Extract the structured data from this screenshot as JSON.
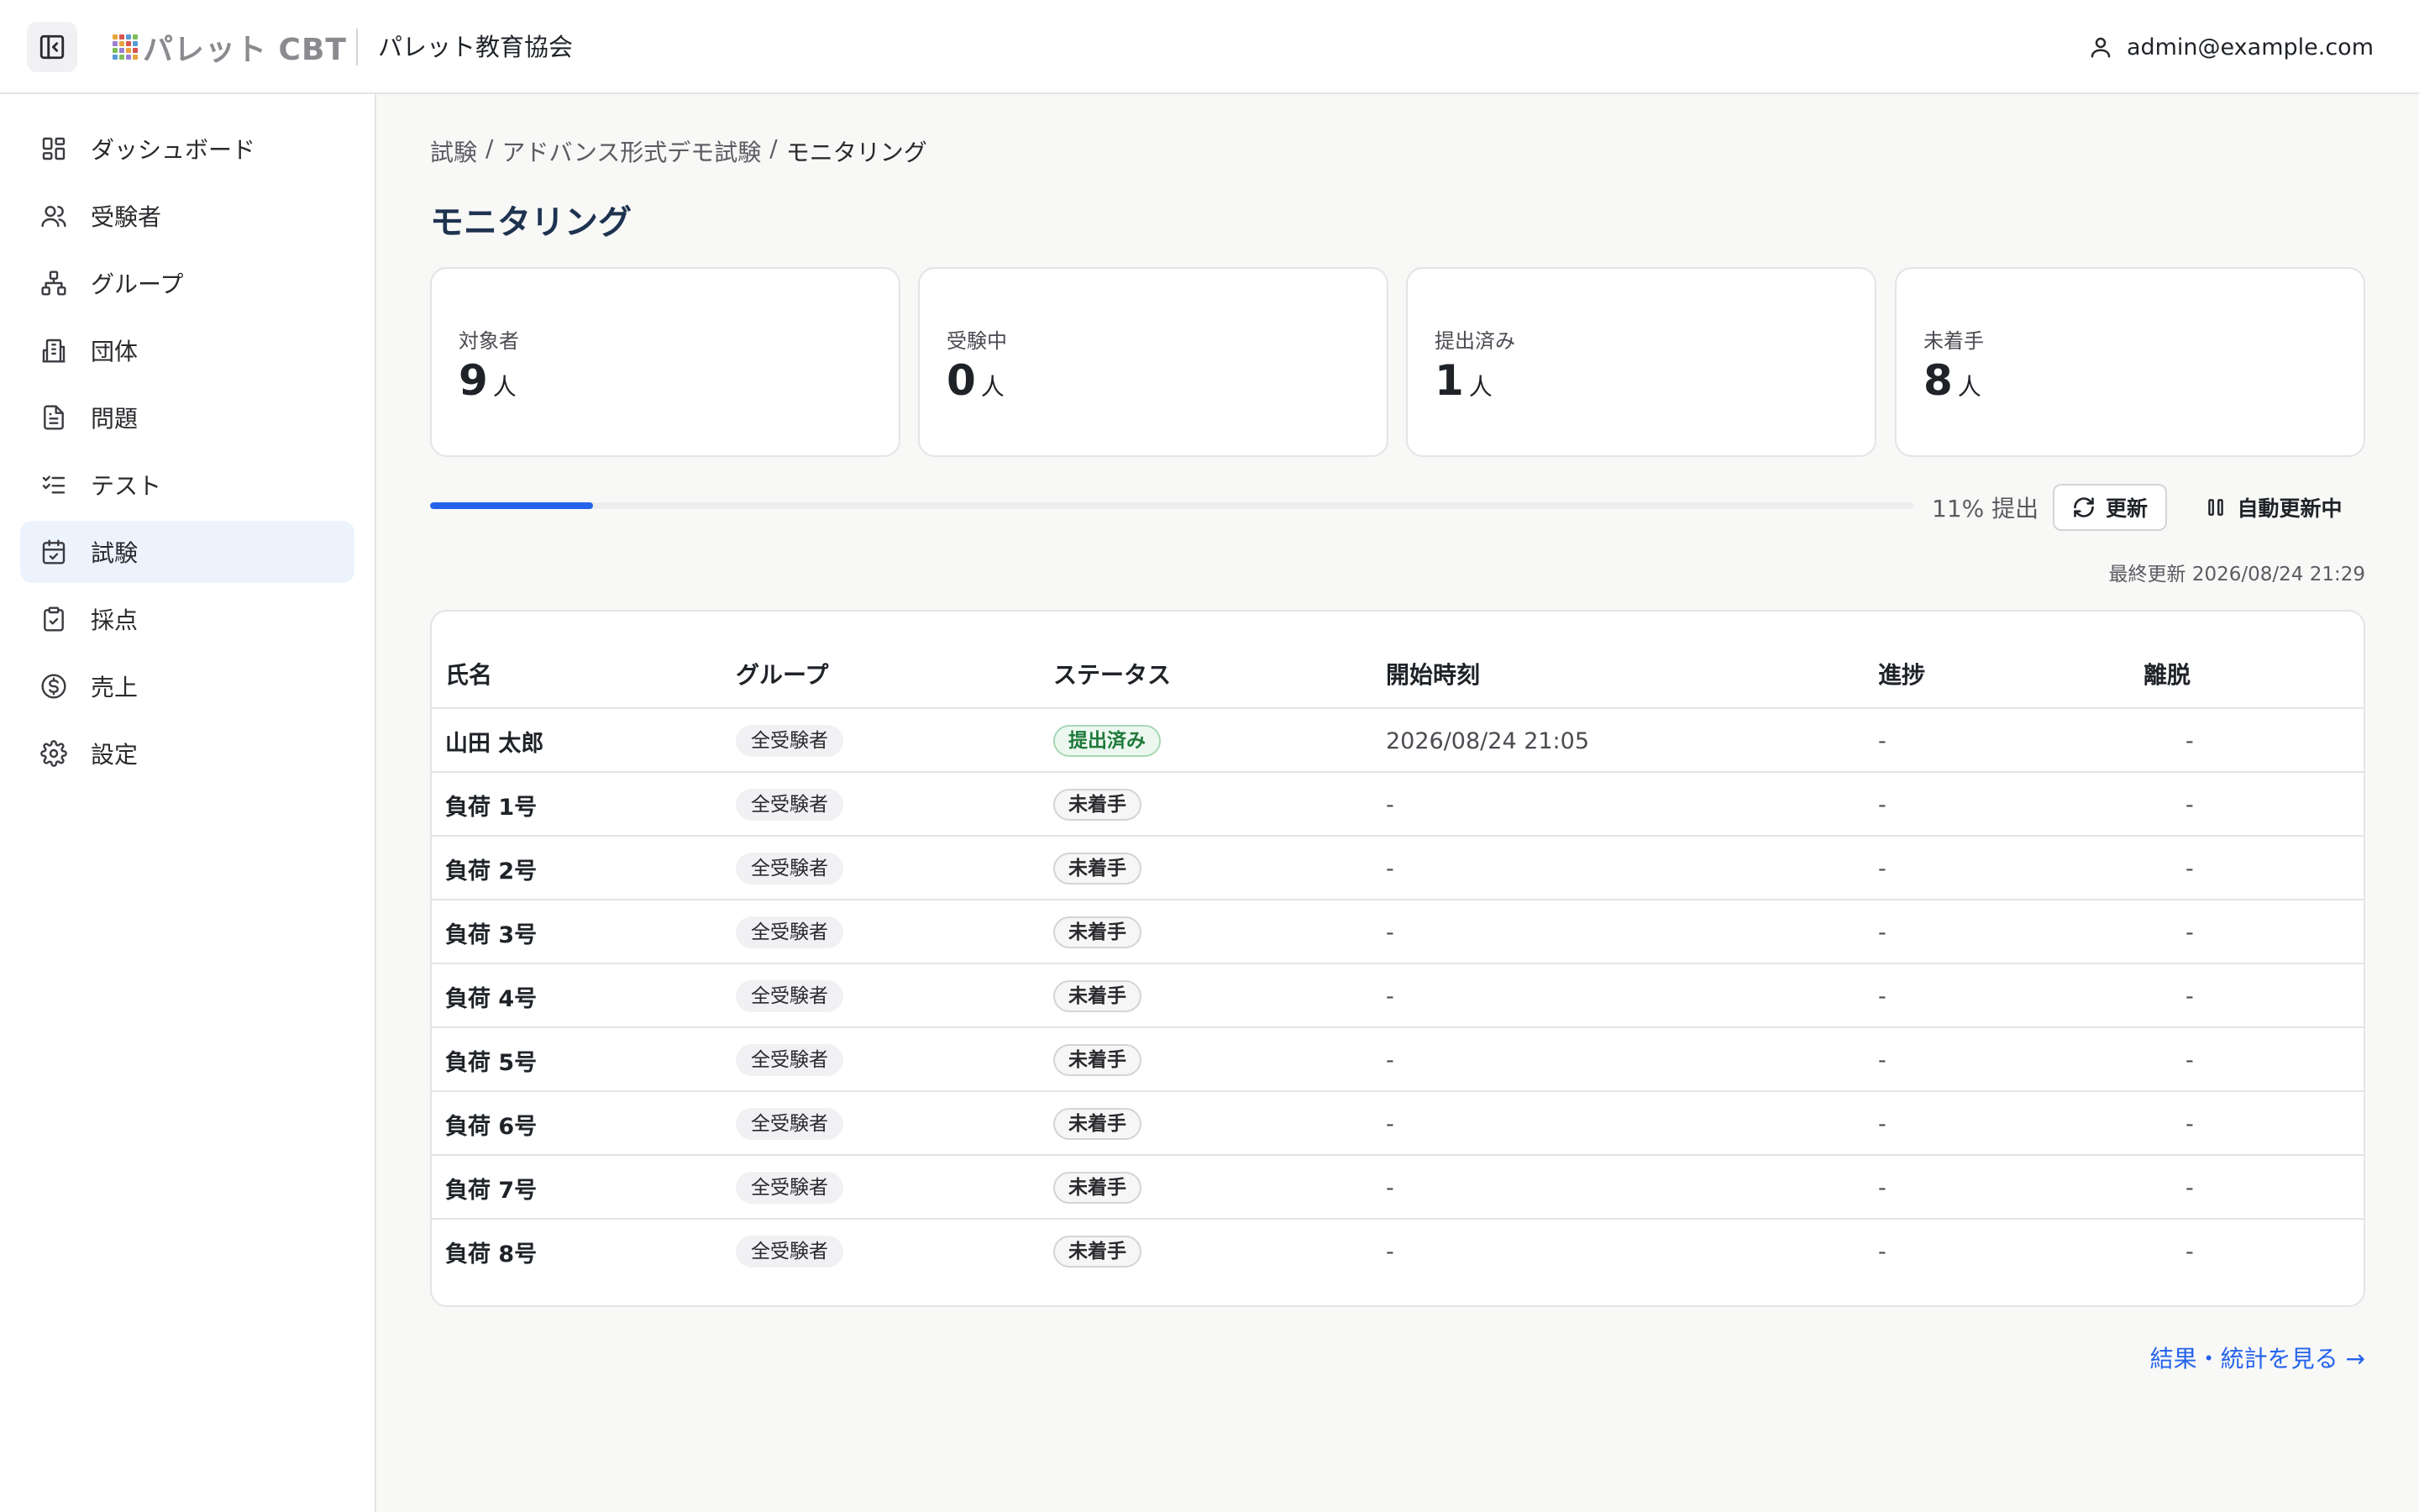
{
  "header": {
    "logo_text": "パレット CBT",
    "org_name": "パレット教育協会",
    "user_email": "admin@example.com"
  },
  "sidebar": {
    "items": [
      {
        "label": "ダッシュボード",
        "icon": "dashboard-icon"
      },
      {
        "label": "受験者",
        "icon": "users-icon"
      },
      {
        "label": "グループ",
        "icon": "network-icon"
      },
      {
        "label": "団体",
        "icon": "building-icon"
      },
      {
        "label": "問題",
        "icon": "document-icon"
      },
      {
        "label": "テスト",
        "icon": "checklist-icon"
      },
      {
        "label": "試験",
        "icon": "calendar-check-icon",
        "active": true
      },
      {
        "label": "採点",
        "icon": "clipboard-check-icon"
      },
      {
        "label": "売上",
        "icon": "dollar-icon"
      },
      {
        "label": "設定",
        "icon": "gear-icon"
      }
    ]
  },
  "breadcrumb": {
    "items": [
      "試験",
      "アドバンス形式デモ試験",
      "モニタリング"
    ],
    "separator": "/"
  },
  "page_title": "モニタリング",
  "stats": [
    {
      "label": "対象者",
      "value": "9",
      "unit": "人"
    },
    {
      "label": "受験中",
      "value": "0",
      "unit": "人"
    },
    {
      "label": "提出済み",
      "value": "1",
      "unit": "人"
    },
    {
      "label": "未着手",
      "value": "8",
      "unit": "人"
    }
  ],
  "progress": {
    "fraction": 0.11,
    "text": "11% 提出",
    "refresh_label": "更新",
    "auto_label": "自動更新中",
    "last_updated": "最終更新 2026/08/24 21:29"
  },
  "table": {
    "columns": [
      "氏名",
      "グループ",
      "ステータス",
      "開始時刻",
      "進捗",
      "離脱"
    ],
    "rows": [
      {
        "name": "山田 太郎",
        "group": "全受験者",
        "status": "提出済み",
        "status_type": "done",
        "start": "2026/08/24 21:05",
        "progress": "-",
        "leave": "-"
      },
      {
        "name": "負荷 1号",
        "group": "全受験者",
        "status": "未着手",
        "status_type": "none",
        "start": "-",
        "progress": "-",
        "leave": "-"
      },
      {
        "name": "負荷 2号",
        "group": "全受験者",
        "status": "未着手",
        "status_type": "none",
        "start": "-",
        "progress": "-",
        "leave": "-"
      },
      {
        "name": "負荷 3号",
        "group": "全受験者",
        "status": "未着手",
        "status_type": "none",
        "start": "-",
        "progress": "-",
        "leave": "-"
      },
      {
        "name": "負荷 4号",
        "group": "全受験者",
        "status": "未着手",
        "status_type": "none",
        "start": "-",
        "progress": "-",
        "leave": "-"
      },
      {
        "name": "負荷 5号",
        "group": "全受験者",
        "status": "未着手",
        "status_type": "none",
        "start": "-",
        "progress": "-",
        "leave": "-"
      },
      {
        "name": "負荷 6号",
        "group": "全受験者",
        "status": "未着手",
        "status_type": "none",
        "start": "-",
        "progress": "-",
        "leave": "-"
      },
      {
        "name": "負荷 7号",
        "group": "全受験者",
        "status": "未着手",
        "status_type": "none",
        "start": "-",
        "progress": "-",
        "leave": "-"
      },
      {
        "name": "負荷 8号",
        "group": "全受験者",
        "status": "未着手",
        "status_type": "none",
        "start": "-",
        "progress": "-",
        "leave": "-"
      }
    ]
  },
  "results_link": "結果・統計を見る →",
  "colors": {
    "accent": "#2563eb",
    "active_nav_bg": "#ecf3fd",
    "title": "#1e3350",
    "done_green": "#1f7a3a"
  }
}
